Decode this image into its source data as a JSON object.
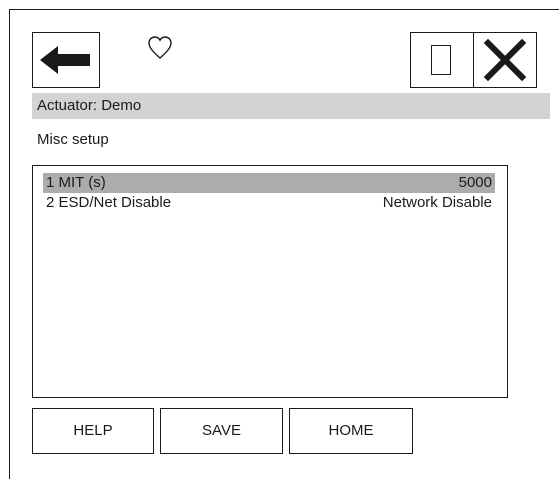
{
  "header": {
    "title": "Actuator: Demo"
  },
  "page": {
    "subtitle": "Misc setup"
  },
  "list": {
    "items": [
      {
        "label": "1 MIT (s)",
        "value": "5000",
        "selected": true
      },
      {
        "label": "2 ESD/Net Disable",
        "value": "Network Disable",
        "selected": false
      }
    ]
  },
  "footer": {
    "help_label": "HELP",
    "save_label": "SAVE",
    "home_label": "HOME"
  },
  "icons": {
    "back": "back-arrow-icon",
    "favorite": "heart-outline-icon",
    "window": "square-icon",
    "close": "close-icon"
  },
  "colors": {
    "header_bg": "#d3d3d3",
    "selected_row_bg": "#acacac",
    "stroke": "#1a1a1a"
  }
}
